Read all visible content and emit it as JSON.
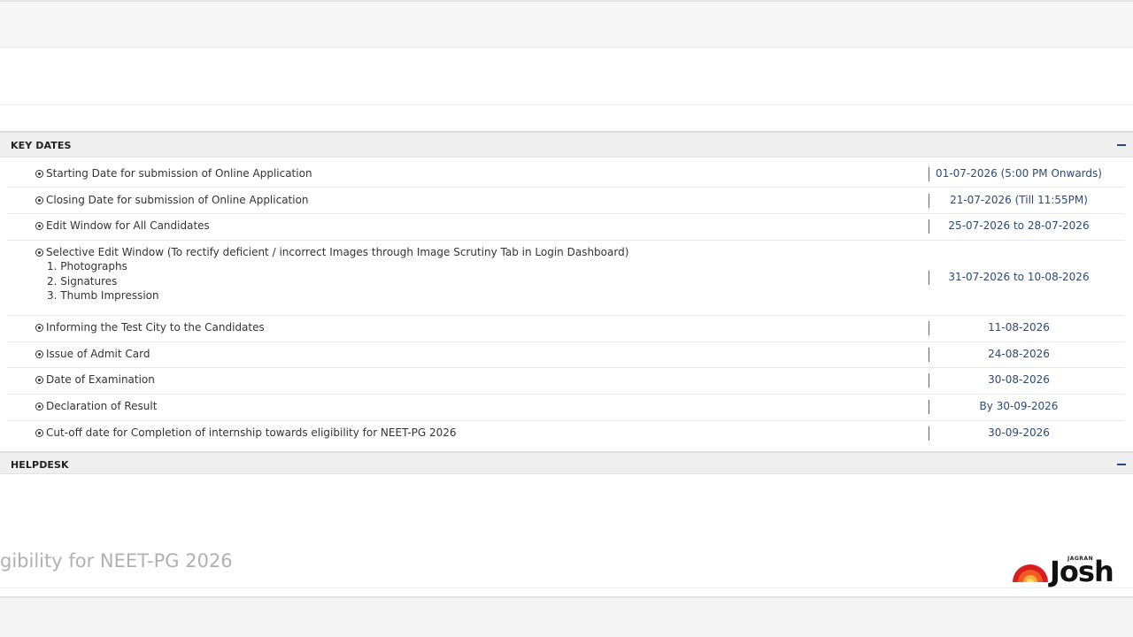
{
  "key_dates": {
    "title": "KEY DATES",
    "rows": [
      {
        "label": "Starting Date for submission of Online Application",
        "date": "01-07-2026 (5:00 PM Onwards)"
      },
      {
        "label": "Closing Date for submission of Online Application",
        "date": "21-07-2026 (Till 11:55PM)"
      },
      {
        "label": "Edit Window for All Candidates",
        "date": "25-07-2026 to 28-07-2026"
      },
      {
        "label": "Selective Edit Window (To rectify deficient / incorrect Images through Image Scrutiny Tab in Login Dashboard)",
        "date": "31-07-2026 to 10-08-2026",
        "sub_items": [
          "1. Photographs",
          "2. Signatures",
          "3. Thumb Impression"
        ]
      },
      {
        "label": "Informing the Test City to the Candidates",
        "date": "11-08-2026"
      },
      {
        "label": "Issue of Admit Card",
        "date": "24-08-2026"
      },
      {
        "label": "Date of Examination",
        "date": "30-08-2026"
      },
      {
        "label": "Declaration of Result",
        "date": "By 30-09-2026"
      },
      {
        "label": "Cut-off date for Completion of internship towards eligibility for NEET-PG 2026",
        "date": "30-09-2026"
      }
    ]
  },
  "helpdesk": {
    "title": "HELPDESK"
  },
  "ghost_text": "gibility for NEET-PG 2026",
  "logo": {
    "top": "JAGRAN",
    "word": "Josh"
  },
  "colors": {
    "accent": "#1e4b8a",
    "date_text": "#2b4a75",
    "header_bg": "#efefef"
  }
}
